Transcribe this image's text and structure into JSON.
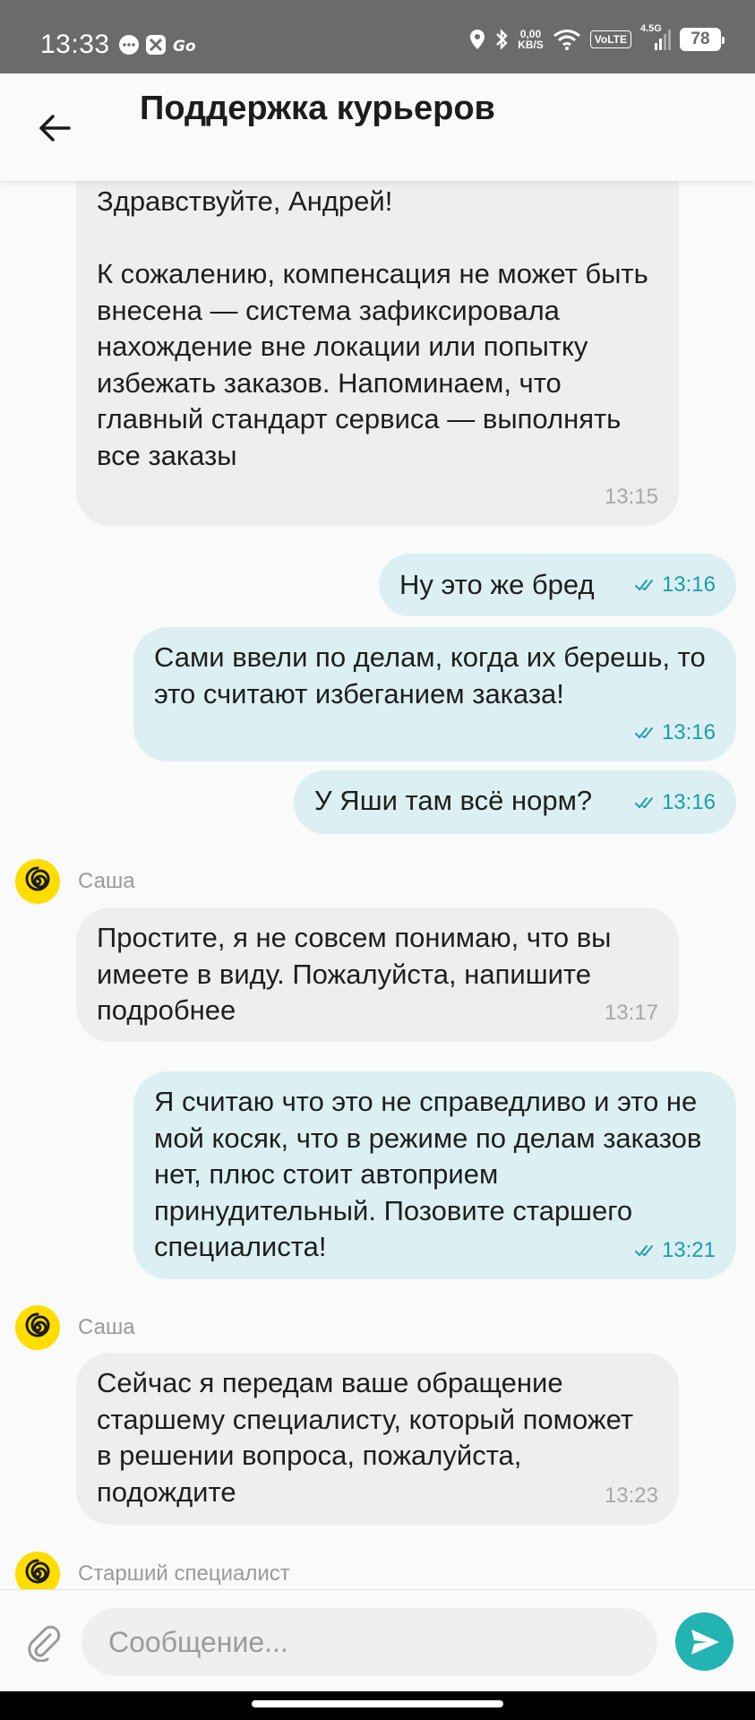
{
  "status_bar": {
    "time": "13:33",
    "speed_value": "0,00",
    "speed_unit": "KB/S",
    "volte": "VoLTE",
    "network": "4.5G",
    "battery": "78"
  },
  "header": {
    "title": "Поддержка курьеров"
  },
  "messages": [
    {
      "type": "incoming",
      "text": "Здравствуйте, Андрей!\n\nК сожалению, компенсация не может быть внесена — система зафиксировала нахождение вне локации или попытку избежать заказов. Напоминаем, что главный стандарт сервиса — выполнять все заказы",
      "time": "13:15"
    },
    {
      "type": "outgoing",
      "text": "Ну это же бред",
      "time": "13:16"
    },
    {
      "type": "outgoing",
      "text": "Сами ввели по делам, когда их берешь, то это считают избеганием заказа!",
      "time": "13:16"
    },
    {
      "type": "outgoing",
      "text": "У Яши там всё норм?",
      "time": "13:16"
    },
    {
      "type": "incoming",
      "sender": "Саша",
      "text": "Простите, я не совсем понимаю, что вы имеете в виду. Пожалуйста, напишите подробнее",
      "time": "13:17"
    },
    {
      "type": "outgoing",
      "text": "Я считаю что это не справедливо и это не мой косяк, что в режиме по делам заказов нет, плюс стоит автоприем принудительный. Позовите старшего специалиста!",
      "time": "13:21"
    },
    {
      "type": "incoming",
      "sender": "Саша",
      "text": "Сейчас я передам ваше обращение старшему специалисту, который поможет в решении вопроса, пожалуйста, подождите",
      "time": "13:23"
    },
    {
      "type": "incoming",
      "sender": "Старший специалист"
    }
  ],
  "input": {
    "placeholder": "Сообщение..."
  },
  "colors": {
    "incoming_bubble": "#eeeeee",
    "outgoing_bubble": "#dcf0f3",
    "accent": "#23b3b3",
    "avatar": "#ffdd00"
  },
  "icons": {
    "back": "arrow-left-icon",
    "attach": "paperclip-icon",
    "send": "send-icon",
    "read_status": "double-check-icon",
    "avatar": "spiral-logo-icon"
  }
}
